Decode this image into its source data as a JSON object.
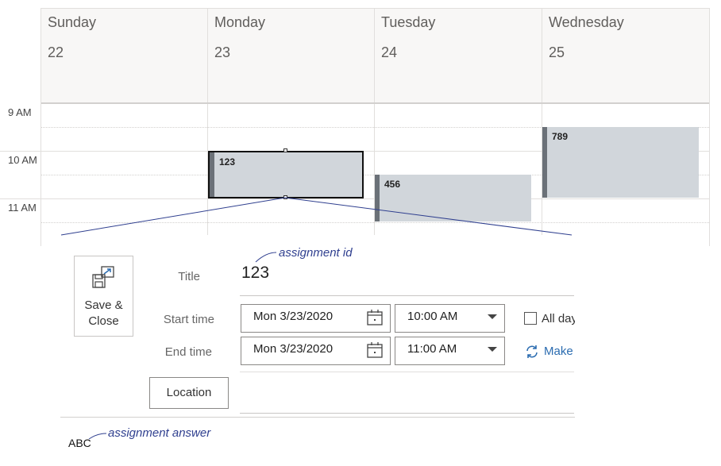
{
  "calendar": {
    "days": [
      {
        "name": "Sunday",
        "date": "22"
      },
      {
        "name": "Monday",
        "date": "23"
      },
      {
        "name": "Tuesday",
        "date": "24"
      },
      {
        "name": "Wednesday",
        "date": "25"
      }
    ],
    "hours": [
      "9 AM",
      "10 AM",
      "11 AM"
    ],
    "events": [
      {
        "title": "123",
        "day": "Monday",
        "start": "10:00 AM",
        "end": "11:00 AM",
        "selected": true
      },
      {
        "title": "456",
        "day": "Tuesday",
        "start": "10:30 AM",
        "end": "11:30 AM",
        "selected": false
      },
      {
        "title": "789",
        "day": "Wednesday",
        "start": "9:30 AM",
        "end": "11:00 AM",
        "selected": false
      }
    ]
  },
  "form": {
    "save_close_label_line1": "Save &",
    "save_close_label_line2": "Close",
    "title_label": "Title",
    "title_value": "123",
    "start_label": "Start time",
    "start_date": "Mon 3/23/2020",
    "start_time": "10:00 AM",
    "end_label": "End time",
    "end_date": "Mon 3/23/2020",
    "end_time": "11:00 AM",
    "all_day_label": "All day",
    "make_recurring_label": "Make",
    "location_label": "Location"
  },
  "annotations": {
    "assignment_id": "assignment id",
    "assignment_answer": "assignment answer",
    "answer_value": "ABC"
  },
  "icons": {
    "save": "save-close-icon",
    "calendar": "calendar-icon",
    "dropdown": "chevron-down-icon",
    "recurring": "repeat-icon"
  },
  "colors": {
    "event_fill": "#d1d6db",
    "event_bar": "#6b7178",
    "annotation": "#2f3f8f",
    "link": "#2b6cb0"
  }
}
